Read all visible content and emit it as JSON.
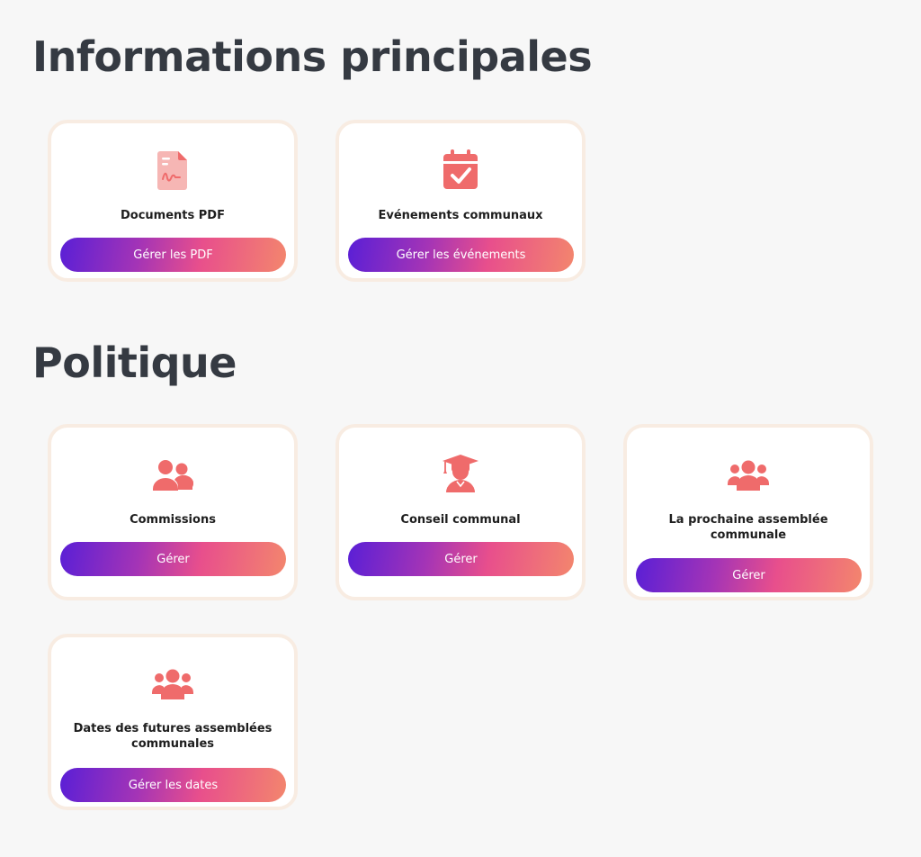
{
  "sections": [
    {
      "title": "Informations principales",
      "cards": [
        {
          "title": "Documents PDF",
          "button": "Gérer les PDF",
          "icon": "pdf-file-icon"
        },
        {
          "title": "Evénements communaux",
          "button": "Gérer les événements",
          "icon": "calendar-check-icon"
        }
      ]
    },
    {
      "title": "Politique",
      "cards": [
        {
          "title": "Commissions",
          "button": "Gérer",
          "icon": "user-pair-icon"
        },
        {
          "title": "Conseil communal",
          "button": "Gérer",
          "icon": "graduate-user-icon"
        },
        {
          "title": "La prochaine assemblée communale",
          "button": "Gérer",
          "icon": "user-group-icon"
        },
        {
          "title": "Dates des futures assemblées communales",
          "button": "Gérer les dates",
          "icon": "user-group-icon"
        }
      ]
    }
  ],
  "colors": {
    "background": "#f7f7f7",
    "heading": "#353a42",
    "icon": "#ef6b6b",
    "card_border": "#f8ece2",
    "button_gradient_start": "#5a1fd6",
    "button_gradient_end": "#f3866d"
  }
}
